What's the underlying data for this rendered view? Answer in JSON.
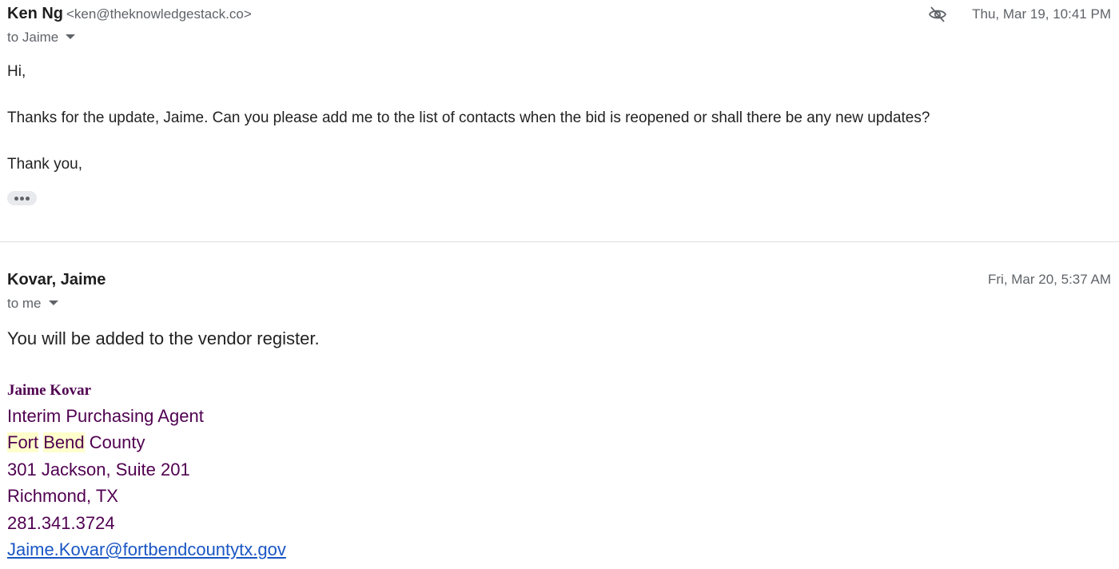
{
  "message1": {
    "sender_name": "Ken Ng",
    "sender_email": "<ken@theknowledgestack.co>",
    "to_label": "to Jaime",
    "date": "Thu, Mar 19, 10:41 PM",
    "icon": "eye-off-icon",
    "body": {
      "greeting": "Hi,",
      "paragraph": "Thanks for the update, Jaime. Can you please add me to the list of contacts when the bid is reopened or shall there be any new updates?",
      "closing": "Thank you,"
    },
    "show_trimmed_icon": "more-horizontal-icon"
  },
  "message2": {
    "sender_name": "Kovar, Jaime",
    "to_label": "to me",
    "date": "Fri, Mar 20, 5:37 AM",
    "body": "You will be added to the vendor register.",
    "signature": {
      "name": "Jaime Kovar",
      "title": "Interim Purchasing Agent",
      "org_part1": "Fort",
      "org_part2": "Bend",
      "org_part3": "County",
      "address": "301 Jackson, Suite 201",
      "city": "Richmond, TX",
      "phone": "281.341.3724",
      "email": "Jaime.Kovar@fortbendcountytx.gov"
    }
  },
  "colors": {
    "signature_text": "#500050",
    "link": "#1a56c4",
    "highlight": "#ffffcc"
  }
}
